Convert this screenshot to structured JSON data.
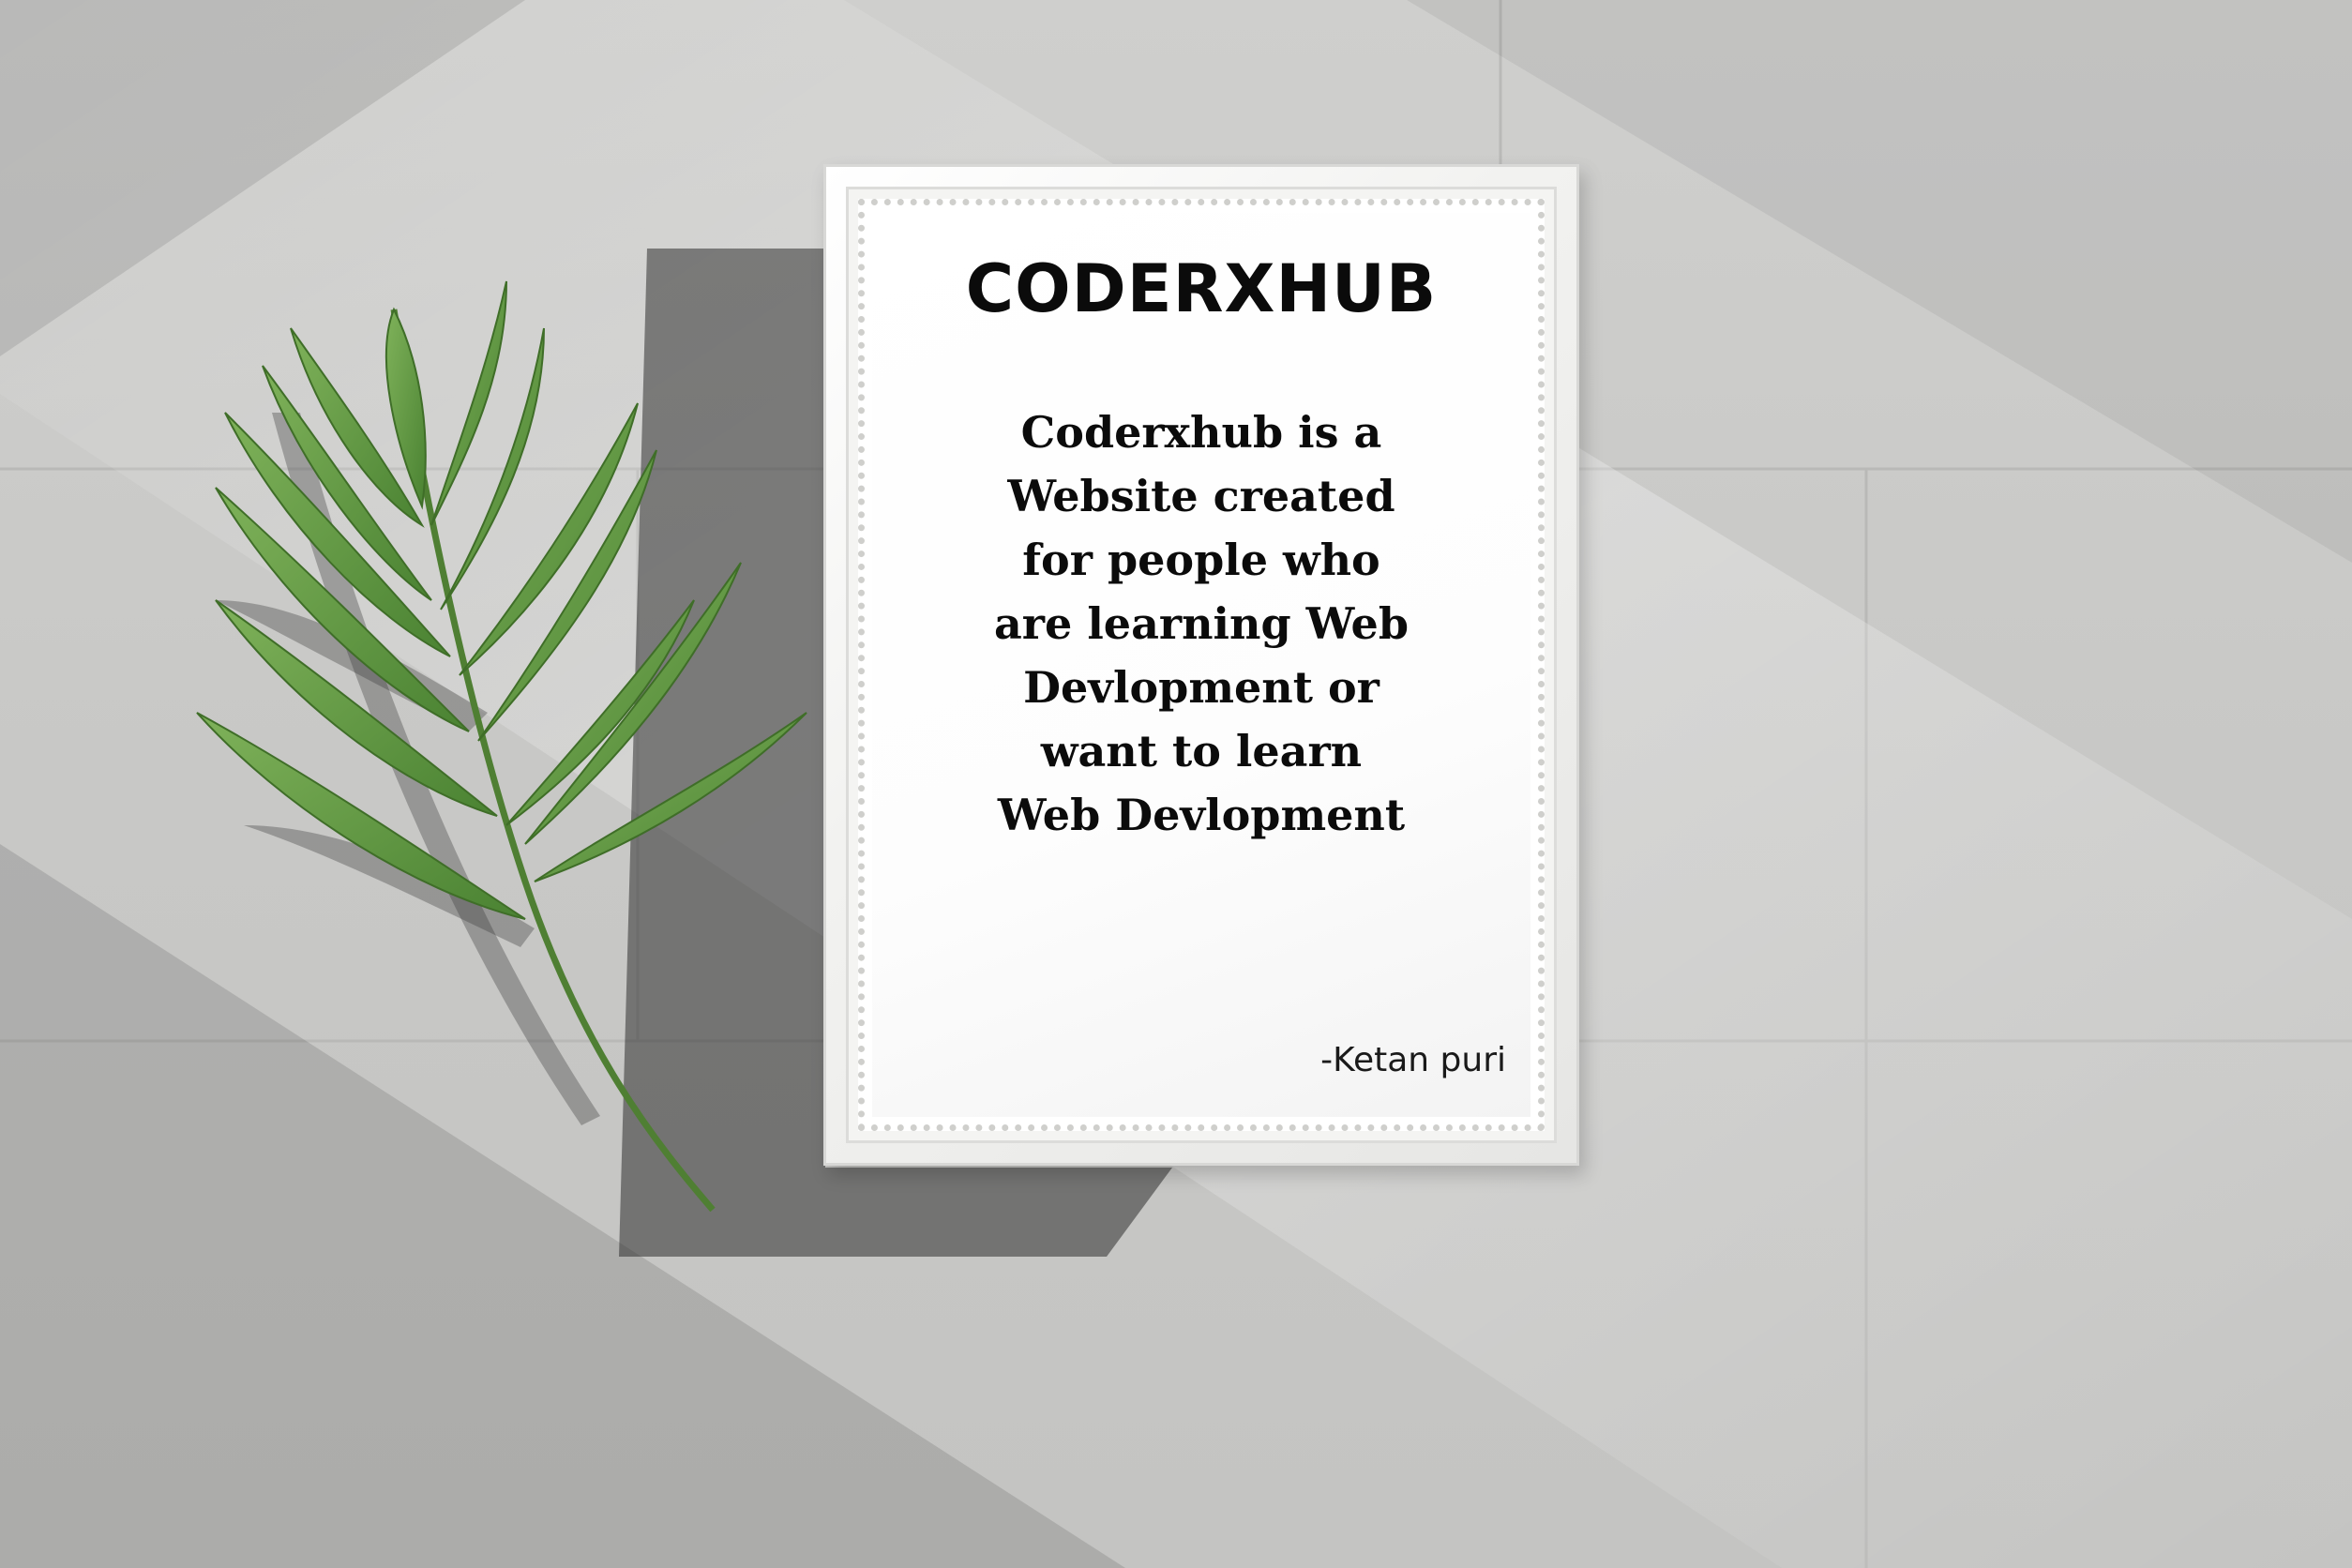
{
  "poster": {
    "title": "CODERXHUB",
    "body_lines": [
      "Coderxhub is a",
      "Website created",
      "for people who",
      "are learning Web",
      "Devlopment or",
      "want to learn",
      "Web Devlopment"
    ],
    "signature": "-Ketan puri"
  },
  "colors": {
    "floor": "#c9c9c7",
    "frame": "#f4f4f2",
    "paper": "#ffffff",
    "text": "#0b0b0b",
    "leaf": "#5e9a3e"
  }
}
